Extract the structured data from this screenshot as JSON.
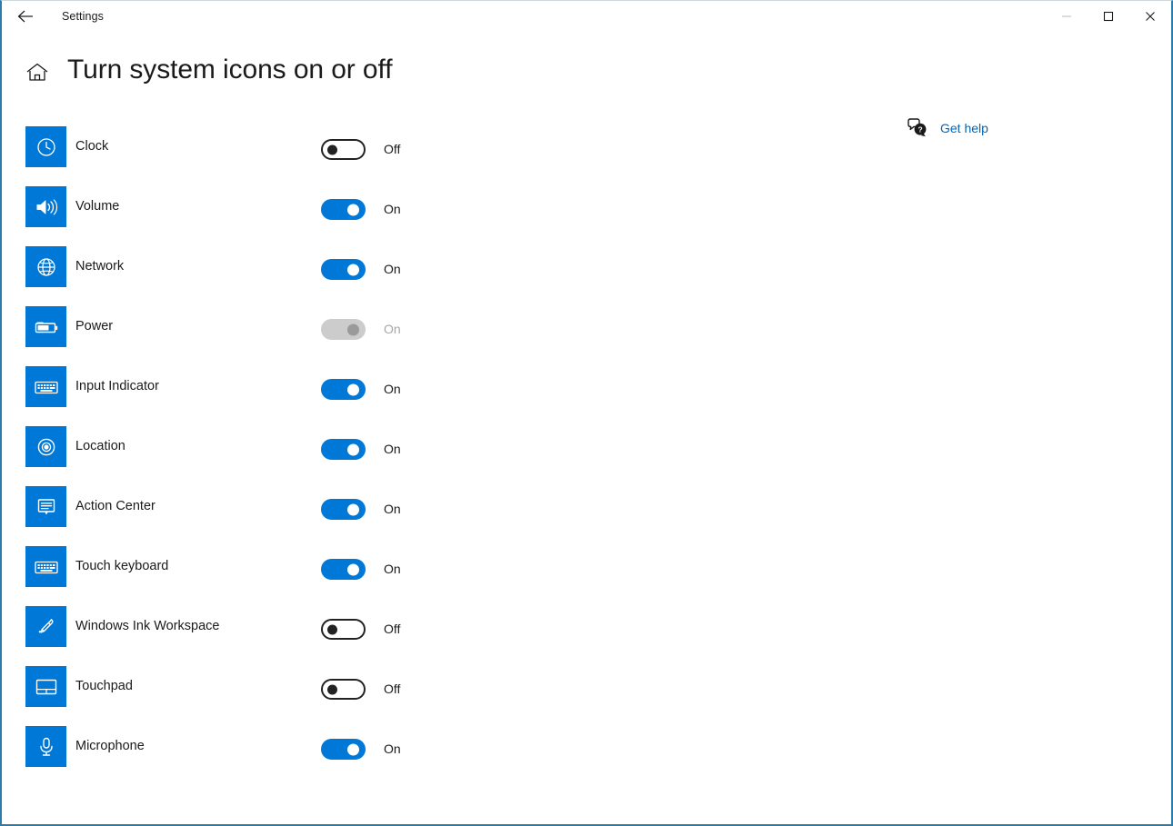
{
  "window": {
    "app_title": "Settings",
    "back_icon": "back-arrow-icon",
    "minimize_icon": "minimize-icon",
    "maximize_icon": "maximize-icon",
    "close_icon": "close-icon",
    "border_color": "#2b7ca8"
  },
  "header": {
    "home_icon": "home-icon",
    "title": "Turn system icons on or off"
  },
  "get_help": {
    "icon": "help-question-bubble-icon",
    "label": "Get help",
    "link_color": "#0067b8"
  },
  "theme": {
    "accent": "#0078d7",
    "tile_bg": "#0078d7",
    "off_border": "#222222",
    "disabled": "#cccccc",
    "text": "#1a1a1a"
  },
  "rows": [
    {
      "label": "Clock",
      "icon": "clock-icon",
      "state": "Off",
      "toggle": "off"
    },
    {
      "label": "Volume",
      "icon": "volume-icon",
      "state": "On",
      "toggle": "on"
    },
    {
      "label": "Network",
      "icon": "network-globe-icon",
      "state": "On",
      "toggle": "on"
    },
    {
      "label": "Power",
      "icon": "battery-power-icon",
      "state": "On",
      "toggle": "disabled"
    },
    {
      "label": "Input Indicator",
      "icon": "keyboard-input-icon",
      "state": "On",
      "toggle": "on"
    },
    {
      "label": "Location",
      "icon": "location-target-icon",
      "state": "On",
      "toggle": "on"
    },
    {
      "label": "Action Center",
      "icon": "action-center-icon",
      "state": "On",
      "toggle": "on"
    },
    {
      "label": "Touch keyboard",
      "icon": "touch-keyboard-icon",
      "state": "On",
      "toggle": "on"
    },
    {
      "label": "Windows Ink Workspace",
      "icon": "pen-ink-icon",
      "state": "Off",
      "toggle": "off"
    },
    {
      "label": "Touchpad",
      "icon": "touchpad-icon",
      "state": "Off",
      "toggle": "off"
    },
    {
      "label": "Microphone",
      "icon": "microphone-icon",
      "state": "On",
      "toggle": "on"
    }
  ]
}
